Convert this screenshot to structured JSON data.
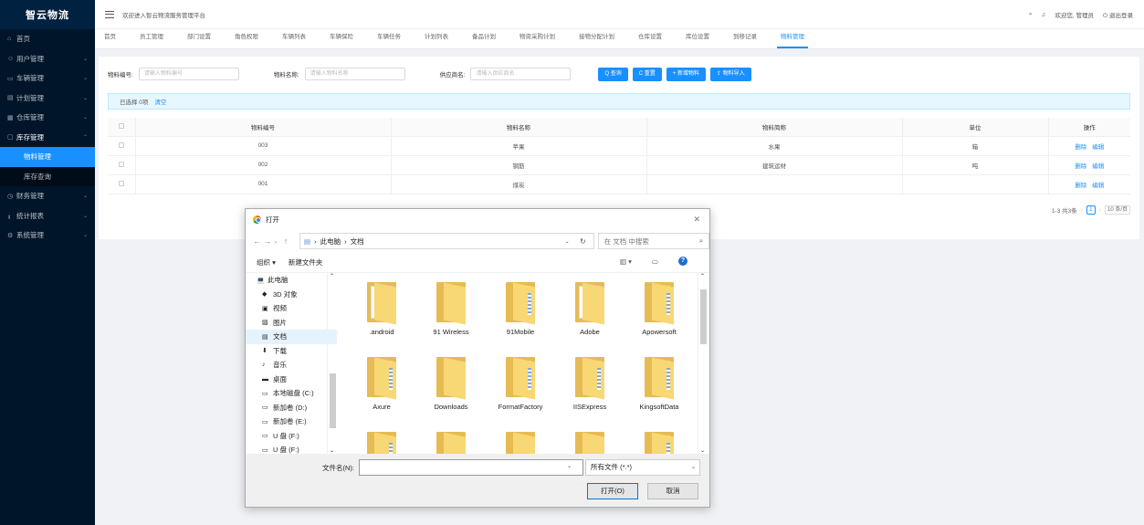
{
  "app": {
    "logo": "智云物流",
    "welcome": "欢迎进入智云物流服务管理平台"
  },
  "header_right": {
    "search_icon": "search-icon",
    "bell_icon": "bell-icon",
    "user_text": "欢迎您, 管理员",
    "logout": "退出登录"
  },
  "sidebar": {
    "items": [
      {
        "icon": "⌂",
        "label": "首页",
        "arrow": ""
      },
      {
        "icon": "☺",
        "label": "用户管理",
        "arrow": "⌄"
      },
      {
        "icon": "▭",
        "label": "车辆管理",
        "arrow": "⌄"
      },
      {
        "icon": "▤",
        "label": "计划管理",
        "arrow": "⌄"
      },
      {
        "icon": "▦",
        "label": "仓库管理",
        "arrow": "⌄"
      },
      {
        "icon": "▢",
        "label": "库存管理",
        "arrow": "⌃"
      }
    ],
    "subitems": [
      {
        "label": "物料管理"
      },
      {
        "label": "库存查询"
      }
    ],
    "items_after": [
      {
        "icon": "◷",
        "label": "财务管理",
        "arrow": "⌄"
      },
      {
        "icon": "╻",
        "label": "统计报表",
        "arrow": "⌄"
      },
      {
        "icon": "⚙",
        "label": "系统管理",
        "arrow": "⌄"
      }
    ]
  },
  "tabs": [
    "首页",
    "员工管理",
    "部门设置",
    "角色权限",
    "车辆列表",
    "车辆保险",
    "车辆任务",
    "计划列表",
    "备品计划",
    "物资采购计划",
    "接物分配计划",
    "仓库设置",
    "库位设置",
    "到移记录",
    "物料管理"
  ],
  "search": {
    "code_label": "物料编号:",
    "code_placeholder": "请输入物料编号",
    "name_label": "物料名称:",
    "name_placeholder": "请输入物料名称",
    "supplier_label": "供应商名:",
    "supplier_placeholder": "请输入供应商名",
    "btn_query": "Q 查询",
    "btn_reset": "C 重置",
    "btn_add": "+ 新增物料",
    "btn_import": "⇪ 物料导入"
  },
  "alert": {
    "text": "已选择 0项",
    "clear": "清空"
  },
  "table": {
    "headers": [
      "物料编号",
      "物料名称",
      "物料简称",
      "单位",
      "操作"
    ],
    "rows": [
      {
        "code": "003",
        "name": "苹果",
        "short": "水果",
        "unit": "箱",
        "del": "删除",
        "edit": "编辑"
      },
      {
        "code": "002",
        "name": "钢筋",
        "short": "建筑运材",
        "unit": "吨",
        "del": "删除",
        "edit": "编辑"
      },
      {
        "code": "001",
        "name": "煤炭",
        "short": "",
        "unit": "",
        "del": "删除",
        "edit": "编辑"
      }
    ]
  },
  "pagination": {
    "summary": "1-3 共3条",
    "current": "1",
    "page_size": "10 条/页"
  },
  "dialog": {
    "title": "打开",
    "path": [
      "此电脑",
      "文档"
    ],
    "search_placeholder": "在 文档 中搜索",
    "organize": "组织 ▾",
    "new_folder": "新建文件夹",
    "tree": [
      {
        "icon": "💻",
        "label": "此电脑"
      },
      {
        "icon": "◆",
        "label": "3D 对象"
      },
      {
        "icon": "▣",
        "label": "视频"
      },
      {
        "icon": "▨",
        "label": "图片"
      },
      {
        "icon": "▤",
        "label": "文档"
      },
      {
        "icon": "⬇",
        "label": "下载"
      },
      {
        "icon": "♪",
        "label": "音乐"
      },
      {
        "icon": "▬",
        "label": "桌面"
      },
      {
        "icon": "▭",
        "label": "本地磁盘 (C:)"
      },
      {
        "icon": "▭",
        "label": "新加卷 (D:)"
      },
      {
        "icon": "▭",
        "label": "新加卷 (E:)"
      },
      {
        "icon": "▭",
        "label": "U 盘 (F:)"
      },
      {
        "icon": "▭",
        "label": "U 盘 (F:)"
      }
    ],
    "folders": [
      ".android",
      "91 Wireless",
      "91Mobile",
      "Adobe",
      "Apowersoft",
      "Axure",
      "Downloads",
      "FormatFactory",
      "IISExpress",
      "KingsoftData",
      "",
      "",
      "",
      "",
      ""
    ],
    "filename_label": "文件名(N):",
    "filetype": "所有文件 (*.*)",
    "open_btn": "打开(O)",
    "cancel_btn": "取消"
  }
}
